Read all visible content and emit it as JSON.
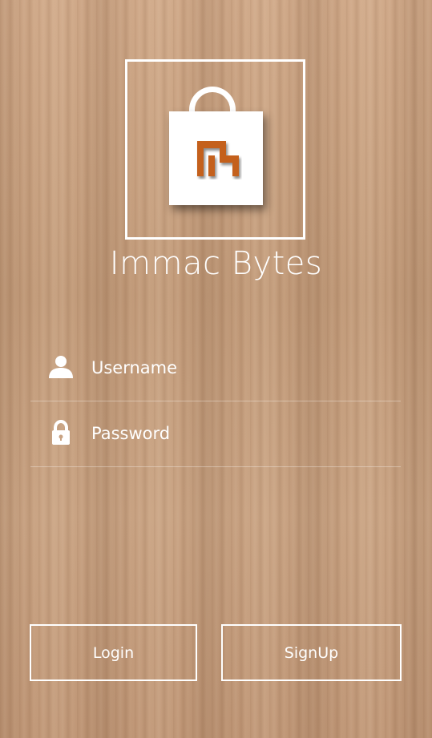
{
  "app": {
    "title": "Immac Bytes"
  },
  "logo": {
    "icon": "shopping-bag-icon",
    "mark_color": "#c4601c"
  },
  "form": {
    "username": {
      "placeholder": "Username",
      "value": "",
      "icon": "user-icon"
    },
    "password": {
      "placeholder": "Password",
      "value": "",
      "icon": "lock-icon"
    }
  },
  "buttons": {
    "login_label": "Login",
    "signup_label": "SignUp"
  }
}
